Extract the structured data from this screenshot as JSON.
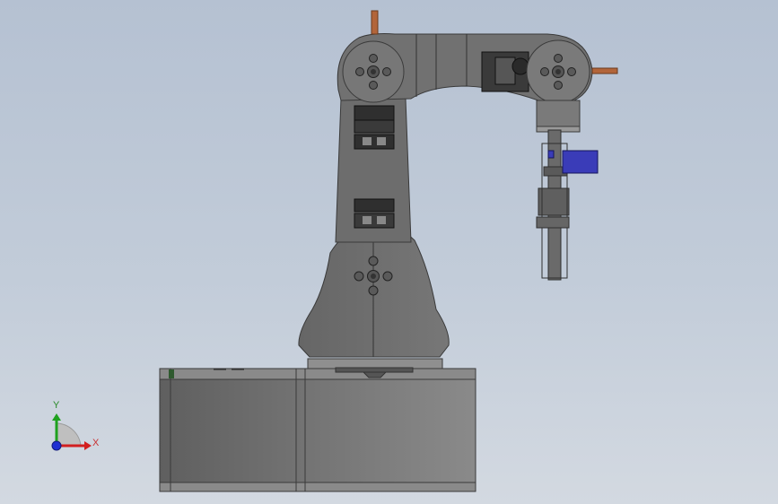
{
  "triad": {
    "y_label": "Y",
    "x_label": "X",
    "colors": {
      "y_axis": "#1fa11f",
      "x_axis": "#d21f1f",
      "z_axis": "#1f2fd2",
      "label_x": "#c83232",
      "label_y": "#2a8a2a"
    }
  },
  "model": {
    "body_color": "#6f6f6f",
    "base_color": "#777777",
    "accent_blue": "#3a3cb8",
    "pin_copper": "#b2653a"
  }
}
